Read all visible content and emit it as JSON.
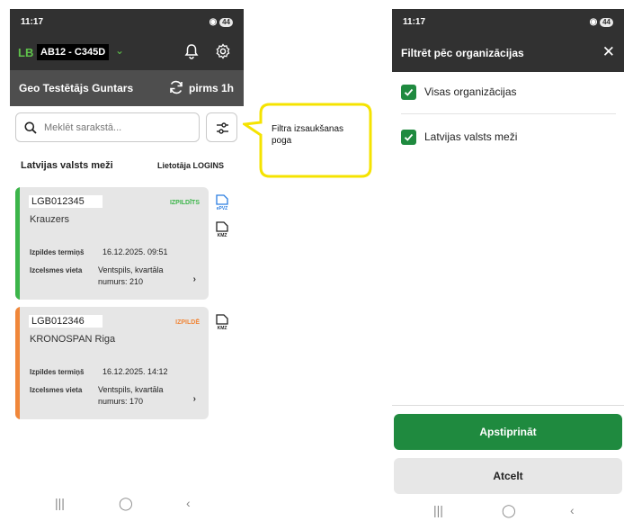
{
  "left": {
    "status_bar": {
      "time": "11:17",
      "dot": "•",
      "battery": "44"
    },
    "header": {
      "vehicle": "AB12 - C345D"
    },
    "subheader": {
      "user": "Geo Testētājs Guntars",
      "sync_text": "pirms 1h"
    },
    "search": {
      "placeholder": "Meklēt sarakstā..."
    },
    "org_name": "Latvijas valsts meži",
    "user_logins": "Lietotāja LOGINS",
    "cards": [
      {
        "id": "LGB012345",
        "customer": "Krauzers",
        "status": "IZPILDĪTS",
        "status_color": "#3cb54a",
        "deadline_label": "Izpildes termiņš",
        "deadline": "16.12.2025. 09:51",
        "place_label": "Izcelsmes vieta",
        "place_line1": "Ventspils, kvartāla",
        "place_line2": "numurs: 210",
        "chevron": "›"
      },
      {
        "id": "LGB012346",
        "customer": "KRONOSPAN Riga",
        "status": "IZPILDĒ",
        "status_color": "#f0873a",
        "deadline_label": "Izpildes termiņš",
        "deadline": "16.12.2025. 14:12",
        "place_label": "Izcelsmes vieta",
        "place_line1": "Ventspils, kvartāla",
        "place_line2": "numurs: 170",
        "chevron": "›"
      }
    ],
    "file_icons": {
      "epvz": "ePVZ",
      "kmz": "KMZ"
    },
    "nav": {
      "recent": "|||",
      "home": "◯",
      "back": "‹"
    }
  },
  "callout": {
    "line1": "Filtra izsaukšanas",
    "line2": "poga"
  },
  "right": {
    "status_bar": {
      "time": "11:17",
      "dot": "•",
      "battery": "44"
    },
    "header": {
      "title": "Filtrēt pēc organizācijas",
      "close": "✕"
    },
    "options": [
      {
        "label": "Visas organizācijas",
        "checked": true
      },
      {
        "label": "Latvijas valsts meži",
        "checked": true
      }
    ],
    "confirm_label": "Apstiprināt",
    "cancel_label": "Atcelt",
    "nav": {
      "recent": "|||",
      "home": "◯",
      "back": "‹"
    }
  },
  "colors": {
    "brand_green": "#1f8a3f",
    "dark_header": "#313131",
    "callout_yellow": "#f5e300"
  }
}
